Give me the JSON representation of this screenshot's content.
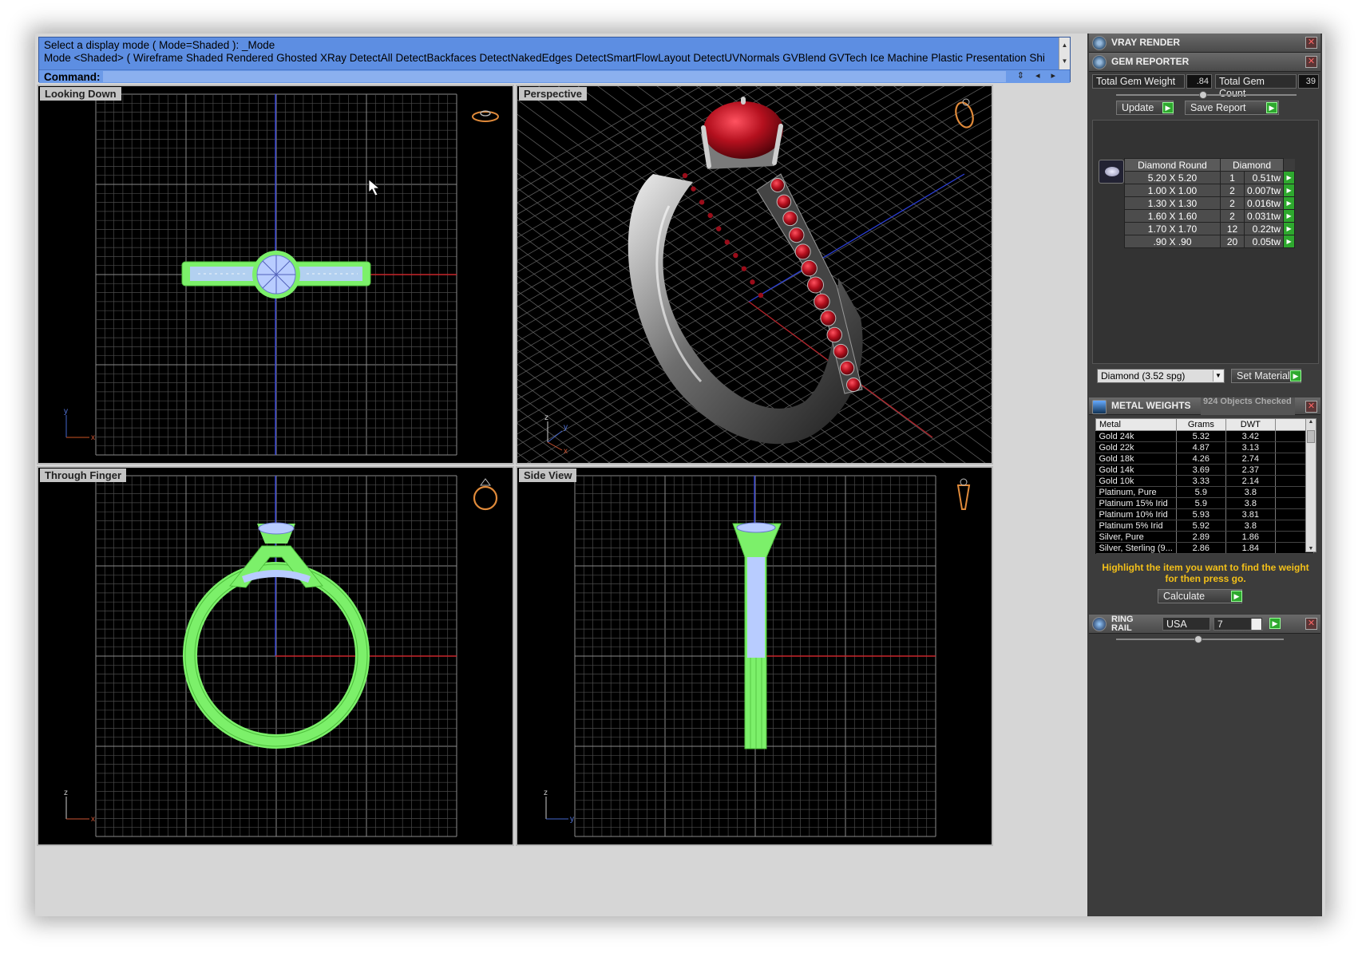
{
  "command": {
    "line1": "Select a display mode ( Mode=Shaded ): _Mode",
    "line2": "Mode <Shaded> ( Wireframe  Shaded  Rendered  Ghosted  XRay  DetectAll  DetectBackfaces  DetectNakedEdges  DetectSmartFlowLayout  DetectUVNormals  GVBlend  GVTech  Ice  Machine  Plastic  Presentation  Shi",
    "prompt_label": "Command:"
  },
  "viewports": {
    "top_left": "Looking Down",
    "top_right": "Perspective",
    "bottom_left": "Through Finger",
    "bottom_right": "Side View"
  },
  "axes": {
    "x": "x",
    "y": "y",
    "z": "z"
  },
  "panels": {
    "vray": {
      "title": "VRAY RENDER"
    },
    "gem": {
      "title": "GEM REPORTER",
      "total_weight_label": "Total Gem Weight",
      "total_weight_value": ".84",
      "total_count_label": "Total Gem Count",
      "total_count_value": "39",
      "update_label": "Update",
      "save_label": "Save Report",
      "columns": [
        "Diamond Round",
        "Diamond"
      ],
      "rows": [
        {
          "size": "5.20 X 5.20",
          "count": "1",
          "wt": "0.51tw"
        },
        {
          "size": "1.00 X 1.00",
          "count": "2",
          "wt": "0.007tw"
        },
        {
          "size": "1.30 X 1.30",
          "count": "2",
          "wt": "0.016tw"
        },
        {
          "size": "1.60 X 1.60",
          "count": "2",
          "wt": "0.031tw"
        },
        {
          "size": "1.70 X 1.70",
          "count": "12",
          "wt": "0.22tw"
        },
        {
          "size": ".90 X .90",
          "count": "20",
          "wt": "0.05tw"
        }
      ],
      "material_select": "Diamond    (3.52 spg)",
      "set_material_label": "Set Material"
    },
    "metal": {
      "title": "METAL WEIGHTS",
      "subtitle": "924 Objects Checked",
      "columns": [
        "Metal",
        "Grams",
        "DWT"
      ],
      "rows": [
        {
          "metal": "Gold 24k",
          "grams": "5.32",
          "dwt": "3.42"
        },
        {
          "metal": "Gold 22k",
          "grams": "4.87",
          "dwt": "3.13"
        },
        {
          "metal": "Gold 18k",
          "grams": "4.26",
          "dwt": "2.74"
        },
        {
          "metal": "Gold 14k",
          "grams": "3.69",
          "dwt": "2.37"
        },
        {
          "metal": "Gold 10k",
          "grams": "3.33",
          "dwt": "2.14"
        },
        {
          "metal": "Platinum, Pure",
          "grams": "5.9",
          "dwt": "3.8"
        },
        {
          "metal": "Platinum 15% Irid",
          "grams": "5.9",
          "dwt": "3.8"
        },
        {
          "metal": "Platinum 10% Irid",
          "grams": "5.93",
          "dwt": "3.81"
        },
        {
          "metal": "Platinum 5% Irid",
          "grams": "5.92",
          "dwt": "3.8"
        },
        {
          "metal": "Silver, Pure",
          "grams": "2.89",
          "dwt": "1.86"
        },
        {
          "metal": "Silver, Sterling (9...",
          "grams": "2.86",
          "dwt": "1.84"
        }
      ],
      "hint": "Highlight the item you want to find the weight for then press go.",
      "calculate_label": "Calculate"
    },
    "ring": {
      "title": "RING RAIL",
      "country": "USA",
      "size": "7"
    }
  },
  "colors": {
    "command_bar": "#5d8ee2",
    "wire_green": "#7cf06a",
    "wire_blue": "#9fb8ff",
    "ruby": "#a3101c",
    "hint_text": "#f3c019",
    "go_button": "#2ea82e"
  }
}
